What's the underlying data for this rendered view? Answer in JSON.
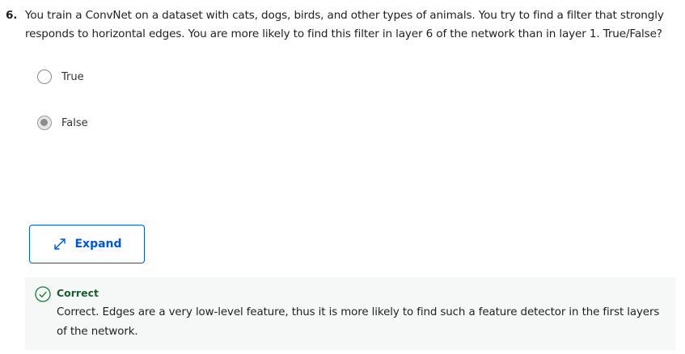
{
  "question": {
    "number": "6.",
    "text": "You train a ConvNet on a dataset with cats, dogs, birds, and other types of animals. You try to find a filter that strongly responds to horizontal edges. You are more likely to find this filter in layer 6 of the network than in layer 1. True/False?"
  },
  "options": [
    {
      "label": "True",
      "selected": false
    },
    {
      "label": "False",
      "selected": true
    }
  ],
  "expand_button": {
    "label": "Expand",
    "icon": "expand-arrows-icon",
    "color": "#0056d2"
  },
  "feedback": {
    "status": "Correct",
    "status_color": "#1d7a3a",
    "text": "Correct. Edges are a very low-level feature, thus it is more likely to find such a feature detector in the first layers of the network."
  }
}
